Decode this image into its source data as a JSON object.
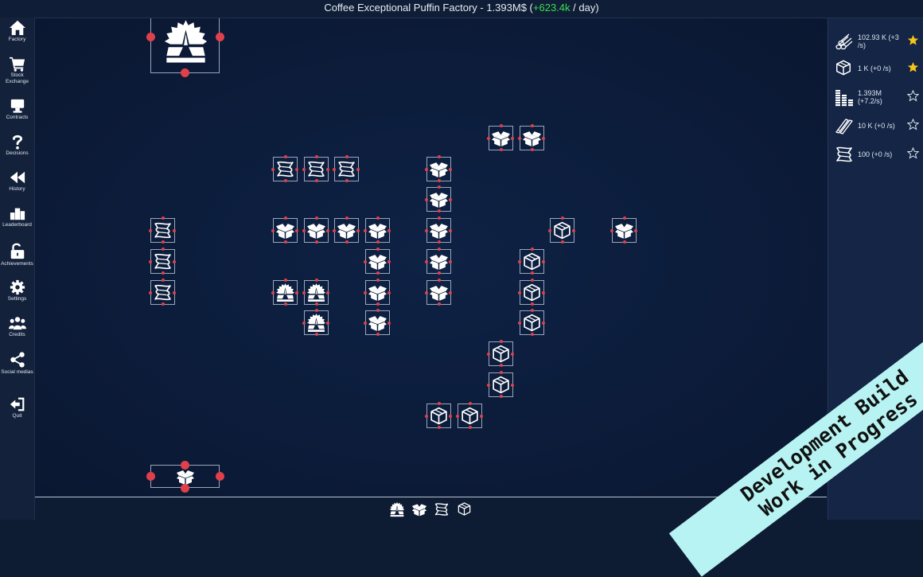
{
  "title": {
    "factory_name": "Coffee Exceptional Puffin Factory",
    "money": "1.393M$",
    "gain": "+623.4k",
    "per_day": "/ day"
  },
  "sidebar": {
    "items": [
      {
        "label": "Factory",
        "icon": "home-icon"
      },
      {
        "label": "Stock Exchange",
        "icon": "cart-icon"
      },
      {
        "label": "Contracts",
        "icon": "contracts-icon"
      },
      {
        "label": "Decisions",
        "icon": "question-icon"
      },
      {
        "label": "History",
        "icon": "rewind-icon"
      },
      {
        "label": "Leaderboard",
        "icon": "podium-icon"
      },
      {
        "label": "Achievements",
        "icon": "lock-icon"
      },
      {
        "label": "Settings",
        "icon": "gear-icon"
      },
      {
        "label": "Credits",
        "icon": "people-icon"
      },
      {
        "label": "Social medias",
        "icon": "share-icon"
      },
      {
        "label": "Quit",
        "icon": "exit-icon"
      }
    ]
  },
  "resources": [
    {
      "text": "102.93 K (+3 /s)",
      "icon": "logs-icon",
      "favorite": true
    },
    {
      "text": "1 K (+0 /s)",
      "icon": "box-icon",
      "favorite": true
    },
    {
      "text": "1.393M (+7.2/s)",
      "icon": "coins-icon",
      "favorite": false
    },
    {
      "text": "10 K (+0 /s)",
      "icon": "planks-icon",
      "favorite": false
    },
    {
      "text": "100 (+0 /s)",
      "icon": "paper-icon",
      "favorite": false
    }
  ],
  "palette": [
    "sawmill-icon",
    "open-box-icon",
    "paper-icon",
    "box-icon"
  ],
  "banner": {
    "line1": "Development Build",
    "line2": "Work in Progress"
  },
  "colors": {
    "gain": "#3fdc52",
    "port": "#e0404a",
    "star_active": "#f5c518",
    "banner": "#b8f3f3"
  }
}
